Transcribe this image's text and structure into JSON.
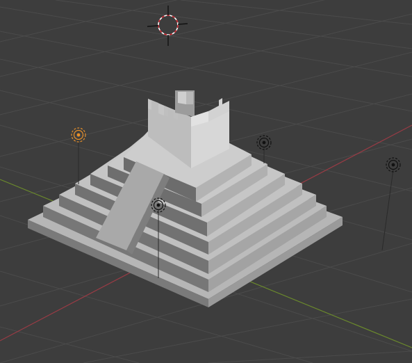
{
  "viewport": {
    "background": "#3d3d3d",
    "grid_color": "#4b4b4b",
    "x_axis_color": "#9a3b45",
    "y_axis_color": "#6b8a2c"
  },
  "scene": {
    "objects": [
      {
        "name": "stepped-pyramid",
        "type": "mesh"
      },
      {
        "name": "castle-tower",
        "type": "mesh"
      }
    ],
    "lights": [
      {
        "name": "light-left",
        "selected": true,
        "color": "#e8902a"
      },
      {
        "name": "light-center",
        "selected": false,
        "color": "#111111"
      },
      {
        "name": "light-back",
        "selected": false,
        "color": "#111111"
      },
      {
        "name": "light-right",
        "selected": false,
        "color": "#111111"
      }
    ],
    "cursor_icon": "3d-cursor-icon",
    "cursor_color": "#c8202a"
  }
}
